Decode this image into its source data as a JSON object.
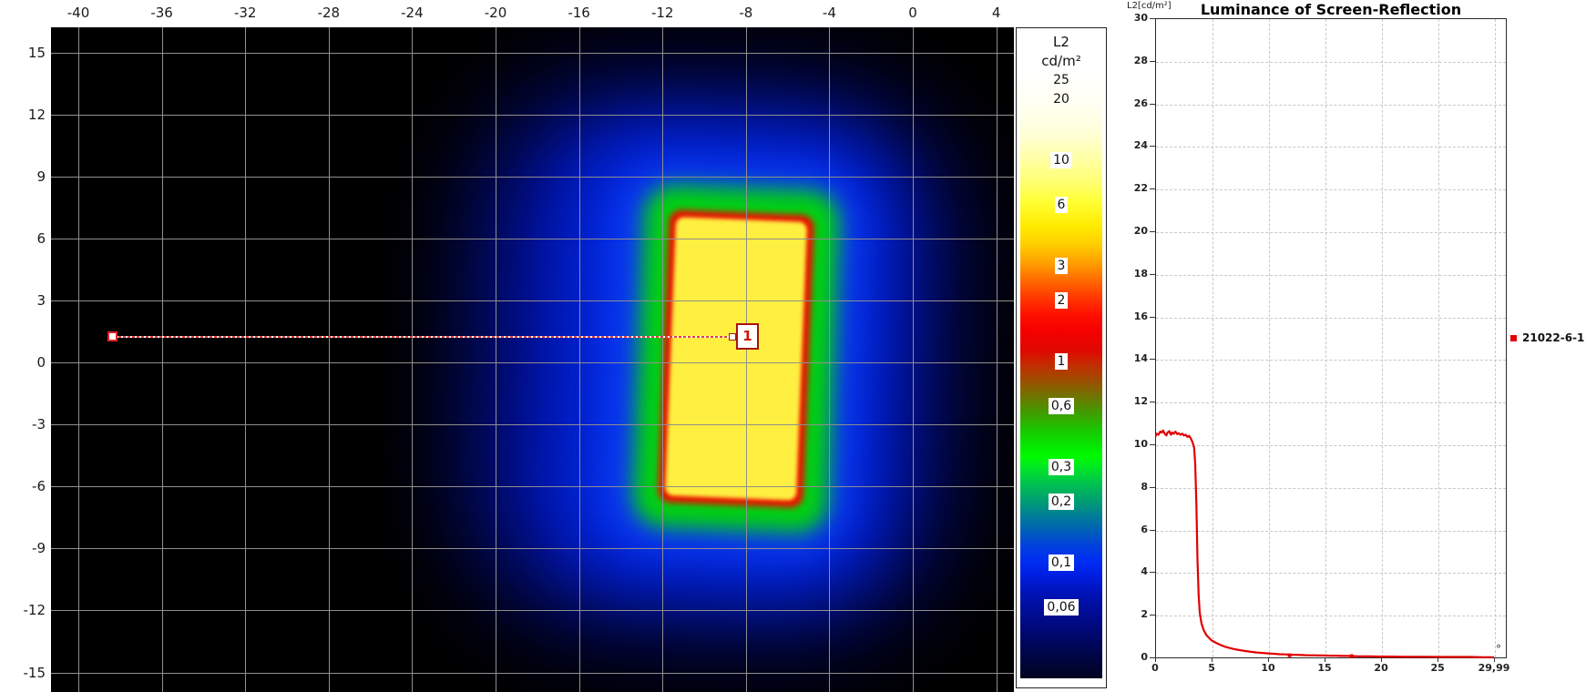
{
  "colors": {
    "curve_red": "#e10000",
    "map_gridline": "#8f8f8f",
    "chart_gridline": "#c8c8c8",
    "map_background": "#000000",
    "reflection_core_yellow": "#ffef40",
    "reflection_border_red": "#ea1200",
    "reflection_glow_green": "#00d011",
    "reflection_halo_blue": "#0b3cf4"
  },
  "map_profile": {
    "marker_label": "1"
  },
  "colorbar": {
    "title_lines": [
      "L2",
      "cd/m²"
    ],
    "labels": [
      {
        "v": 25,
        "text": "25",
        "chip": false
      },
      {
        "v": 20,
        "text": "20",
        "chip": false
      },
      {
        "v": 10,
        "text": "10",
        "chip": true
      },
      {
        "v": 6,
        "text": "6",
        "chip": true
      },
      {
        "v": 3,
        "text": "3",
        "chip": true
      },
      {
        "v": 2,
        "text": "2",
        "chip": true
      },
      {
        "v": 1,
        "text": "1",
        "chip": true
      },
      {
        "v": 0.6,
        "text": "0,6",
        "chip": true
      },
      {
        "v": 0.3,
        "text": "0,3",
        "chip": true
      },
      {
        "v": 0.2,
        "text": "0,2",
        "chip": true
      },
      {
        "v": 0.1,
        "text": "0,1",
        "chip": true
      },
      {
        "v": 0.06,
        "text": "0,06",
        "chip": true
      }
    ]
  },
  "chart_data": [
    {
      "type": "heatmap",
      "name": "false-color-luminance-map",
      "x_unit": "deg",
      "y_unit": "deg",
      "x_ticks": [
        -40,
        -36,
        -32,
        -28,
        -24,
        -20,
        -16,
        -12,
        -8,
        -4,
        0,
        4
      ],
      "y_ticks": [
        15,
        12,
        9,
        6,
        3,
        0,
        -3,
        -6,
        -9,
        -12,
        -15
      ],
      "x_range": [
        -41.3,
        4.9
      ],
      "y_range": [
        -16,
        16.2
      ],
      "grid": true,
      "color_scale": {
        "quantity": "L2",
        "unit": "cd/m²",
        "scale": "log",
        "tick_values": [
          25,
          20,
          10,
          6,
          3,
          2,
          1,
          0.6,
          0.3,
          0.2,
          0.1,
          0.06
        ]
      },
      "reflection_patch": {
        "x_deg": [
          -12.3,
          -4.8
        ],
        "y_deg": [
          -7.0,
          7.4
        ],
        "core_level_cdm2": "≥10 (yellow core)",
        "border_level_cdm2": "≈2 (red rim)",
        "halo_levels_cdm2": "green ≈0.3–0.6, blue ≈0.06–0.2, black <0.06",
        "tilt_deg": 2.3
      },
      "profile_line": {
        "y_deg": 1.25,
        "x_from_deg": -38.4,
        "x_to_deg": -8.5,
        "marker_label": "1"
      }
    },
    {
      "type": "line",
      "title": "Luminance of Screen-Reflection",
      "ylabel": "L2[cd/m²]",
      "x_unit": "°",
      "xlim": [
        0,
        29.99
      ],
      "ylim": [
        0,
        30
      ],
      "grid": "dashed",
      "y_ticks": [
        0,
        2,
        4,
        6,
        8,
        10,
        12,
        14,
        16,
        18,
        20,
        22,
        24,
        26,
        28,
        30
      ],
      "x_ticks": [
        {
          "v": 0,
          "label": "0"
        },
        {
          "v": 5,
          "label": "5"
        },
        {
          "v": 10,
          "label": "10"
        },
        {
          "v": 15,
          "label": "15"
        },
        {
          "v": 20,
          "label": "20"
        },
        {
          "v": 25,
          "label": "25"
        },
        {
          "v": 29.99,
          "label": "29,99"
        }
      ],
      "legend": {
        "position": "right-middle",
        "name": "21022-6-1",
        "color": "#e10000"
      },
      "series": [
        {
          "name": "21022-6-1",
          "color": "#e10000",
          "points": [
            [
              0,
              10.35
            ],
            [
              0.15,
              10.5
            ],
            [
              0.3,
              10.45
            ],
            [
              0.45,
              10.6
            ],
            [
              0.6,
              10.55
            ],
            [
              0.7,
              10.65
            ],
            [
              0.85,
              10.5
            ],
            [
              1,
              10.42
            ],
            [
              1.1,
              10.55
            ],
            [
              1.25,
              10.62
            ],
            [
              1.4,
              10.45
            ],
            [
              1.5,
              10.55
            ],
            [
              1.65,
              10.5
            ],
            [
              1.8,
              10.6
            ],
            [
              1.95,
              10.48
            ],
            [
              2.1,
              10.52
            ],
            [
              2.25,
              10.45
            ],
            [
              2.4,
              10.5
            ],
            [
              2.55,
              10.42
            ],
            [
              2.7,
              10.45
            ],
            [
              2.85,
              10.35
            ],
            [
              3,
              10.4
            ],
            [
              3.15,
              10.28
            ],
            [
              3.3,
              10.12
            ],
            [
              3.45,
              9.85
            ],
            [
              3.55,
              9.1
            ],
            [
              3.65,
              7.2
            ],
            [
              3.75,
              4.6
            ],
            [
              3.85,
              2.9
            ],
            [
              3.95,
              2.1
            ],
            [
              4.1,
              1.6
            ],
            [
              4.3,
              1.28
            ],
            [
              4.55,
              1.04
            ],
            [
              4.8,
              0.9
            ],
            [
              5,
              0.8
            ],
            [
              5.4,
              0.68
            ],
            [
              5.8,
              0.58
            ],
            [
              6.2,
              0.5
            ],
            [
              6.6,
              0.44
            ],
            [
              7,
              0.39
            ],
            [
              7.5,
              0.34
            ],
            [
              8,
              0.3
            ],
            [
              8.5,
              0.26
            ],
            [
              9,
              0.23
            ],
            [
              9.5,
              0.21
            ],
            [
              10,
              0.19
            ],
            [
              10.5,
              0.17
            ],
            [
              11,
              0.15
            ],
            [
              11.5,
              0.14
            ],
            [
              12,
              0.13
            ],
            [
              12.5,
              0.12
            ],
            [
              13,
              0.11
            ],
            [
              13.5,
              0.1
            ],
            [
              14,
              0.1
            ],
            [
              14.5,
              0.09
            ],
            [
              15,
              0.09
            ],
            [
              15.5,
              0.08
            ],
            [
              16,
              0.08
            ],
            [
              16.5,
              0.07
            ],
            [
              17,
              0.07
            ],
            [
              17.5,
              0.06
            ],
            [
              18,
              0.05
            ],
            [
              19,
              0.05
            ],
            [
              20,
              0.04
            ],
            [
              21,
              0.04
            ],
            [
              22,
              0.03
            ],
            [
              23,
              0.03
            ],
            [
              24,
              0.03
            ],
            [
              25,
              0.02
            ],
            [
              26,
              0.02
            ],
            [
              27,
              0.02
            ],
            [
              28,
              0.02
            ],
            [
              29,
              0.01
            ],
            [
              29.99,
              0.01
            ]
          ]
        }
      ],
      "point_markers": [
        [
          11.9,
          0.1
        ],
        [
          17.4,
          0.06
        ]
      ]
    }
  ]
}
